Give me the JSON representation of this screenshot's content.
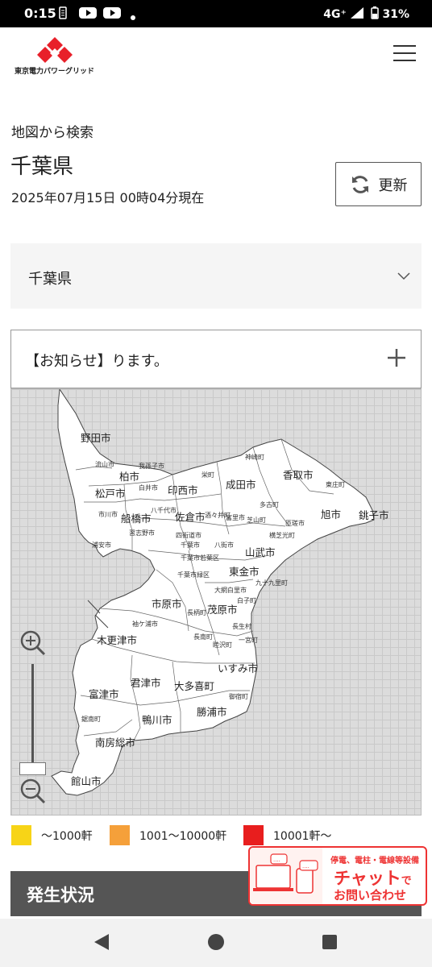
{
  "status_bar": {
    "time": "0:15",
    "network": "4G⁺",
    "battery": "31%",
    "icons": [
      "notification-icon",
      "youtube-icon",
      "youtube-icon",
      "dot-icon",
      "signal-icon",
      "battery-icon"
    ]
  },
  "header": {
    "logo_text": "東京電力パワーグリッド",
    "brand_color": "#e8202a"
  },
  "page": {
    "breadcrumb": "地図から検索",
    "title": "千葉県",
    "timestamp": "2025年07月15日 00時04分現在",
    "refresh_label": "更新"
  },
  "prefecture_select": {
    "value": "千葉県"
  },
  "notice": {
    "text": "【お知らせ】ります。"
  },
  "map": {
    "cities": [
      "野田市",
      "流山市",
      "柏市",
      "我孫子市",
      "栄町",
      "神崎町",
      "香取市",
      "松戸市",
      "白井市",
      "印西市",
      "成田市",
      "東庄町",
      "市川市",
      "船橋市",
      "八千代市",
      "佐倉市",
      "酒々井町",
      "富里市",
      "芝山町",
      "多古町",
      "旭市",
      "銚子市",
      "習志野市",
      "浦安市",
      "四街道市",
      "八街市",
      "横芝光町",
      "匝瑳市",
      "千葉市",
      "山武市",
      "千葉市若葉区",
      "千葉市緑区",
      "東金市",
      "九十九里町",
      "大網白里市",
      "市原市",
      "茂原市",
      "白子町",
      "長柄町",
      "長生村",
      "袖ケ浦市",
      "木更津市",
      "長南町",
      "睦沢町",
      "一宮町",
      "君津市",
      "いすみ市",
      "富津市",
      "大多喜町",
      "御宿町",
      "鋸南町",
      "鴨川市",
      "勝浦市",
      "南房総市",
      "館山市"
    ]
  },
  "legend": [
    {
      "label": "〜1000軒",
      "color": "#f7d417"
    },
    {
      "label": "1001〜10000軒",
      "color": "#f5a03a"
    },
    {
      "label": "10001軒〜",
      "color": "#e81e1e"
    }
  ],
  "status_section": {
    "title": "発生状況"
  },
  "chat_banner": {
    "top_text": "停電、電柱・電線等設備",
    "main_text": "チャット",
    "main_suffix": "で",
    "sub_text": "お問い合わせ"
  }
}
